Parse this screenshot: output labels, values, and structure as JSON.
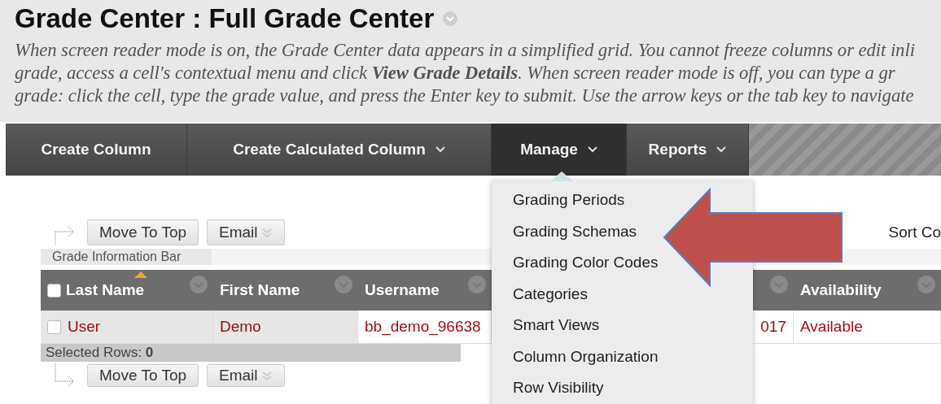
{
  "page": {
    "title": "Grade Center : Full Grade Center",
    "description_lines": [
      "When screen reader mode is on, the Grade Center data appears in a simplified grid. You cannot freeze columns or edit inli",
      "grade, access a cell's contextual menu and click **View Grade Details**. When screen reader mode is off, you can type a gr",
      "grade: click the cell, type the grade value, and press the Enter key to submit. Use the arrow keys or the tab key to navigate"
    ]
  },
  "nav": [
    {
      "label": "Create Column",
      "selected": false,
      "dropdown": false
    },
    {
      "label": "Create Calculated Column",
      "selected": false,
      "dropdown": true
    },
    {
      "label": "Manage",
      "selected": true,
      "dropdown": true
    },
    {
      "label": "Reports",
      "selected": false,
      "dropdown": true
    }
  ],
  "manage_menu": {
    "items": [
      "Grading Periods",
      "Grading Schemas",
      "Grading Color Codes",
      "Categories",
      "Smart Views",
      "Column Organization",
      "Row Visibility"
    ]
  },
  "toolbar_top": {
    "buttons": [
      {
        "label": "Move To Top",
        "kind": "plain"
      },
      {
        "label": "Email",
        "kind": "menu"
      }
    ]
  },
  "sort_label": "Sort Co",
  "info_bar": "Grade Information Bar",
  "table": {
    "select_all_checked": false,
    "columns": [
      {
        "label": "Last Name",
        "sorted": true
      },
      {
        "label": "First Name",
        "sorted": false
      },
      {
        "label": "Username",
        "sorted": false
      },
      {},
      {
        "label": "Availability",
        "sorted": false
      }
    ],
    "rows": [
      {
        "checked": false,
        "cells": [
          "User",
          "Demo",
          "bb_demo_96638",
          "017",
          "Available"
        ]
      }
    ]
  },
  "selected_rows": {
    "label": "Selected Rows:",
    "count": "0"
  },
  "toolbar_bottom": {
    "buttons": [
      {
        "label": "Move To Top",
        "kind": "plain"
      },
      {
        "label": "Email",
        "kind": "menu"
      }
    ]
  }
}
